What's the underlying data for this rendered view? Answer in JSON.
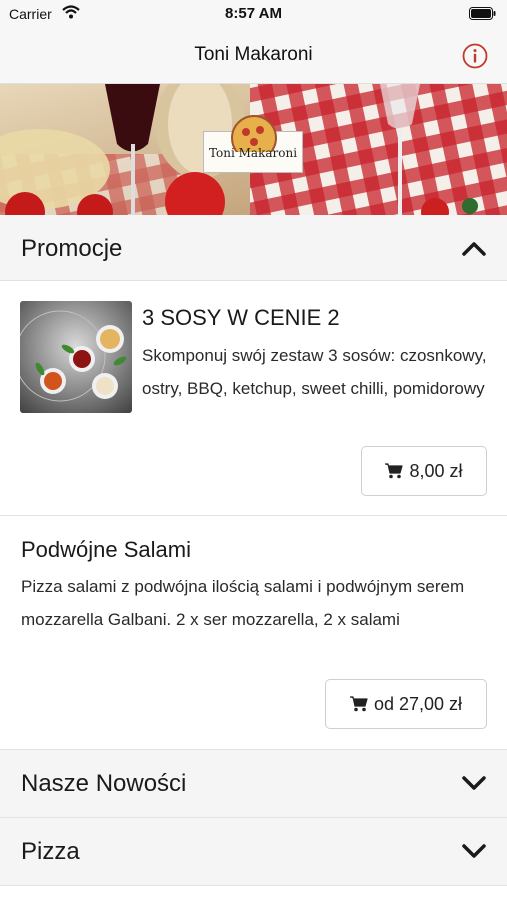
{
  "status_bar": {
    "carrier": "Carrier",
    "time": "8:57 AM"
  },
  "nav": {
    "title": "Toni Makaroni"
  },
  "banner": {
    "logo_text": "Toni Makaroni"
  },
  "sections": [
    {
      "title": "Promocje",
      "expanded": true
    },
    {
      "title": "Nasze Nowości",
      "expanded": false
    },
    {
      "title": "Pizza",
      "expanded": false
    }
  ],
  "items": [
    {
      "name": "3 SOSY W CENIE 2",
      "description": "Skomponuj swój zestaw 3 sosów: czosnkowy, ostry, BBQ, ketchup, sweet chilli, pomidorowy",
      "price": "8,00 zł"
    },
    {
      "name": "Podwójne Salami",
      "description": "Pizza salami z podwójna ilością salami i podwójnym serem mozzarella Galbani. 2 x ser mozzarella, 2 x salami",
      "price": "od 27,00 zł"
    }
  ],
  "colors": {
    "accent": "#c0392b",
    "header_bg": "#f5f5f5",
    "nav_bg": "#f7f7f7"
  }
}
